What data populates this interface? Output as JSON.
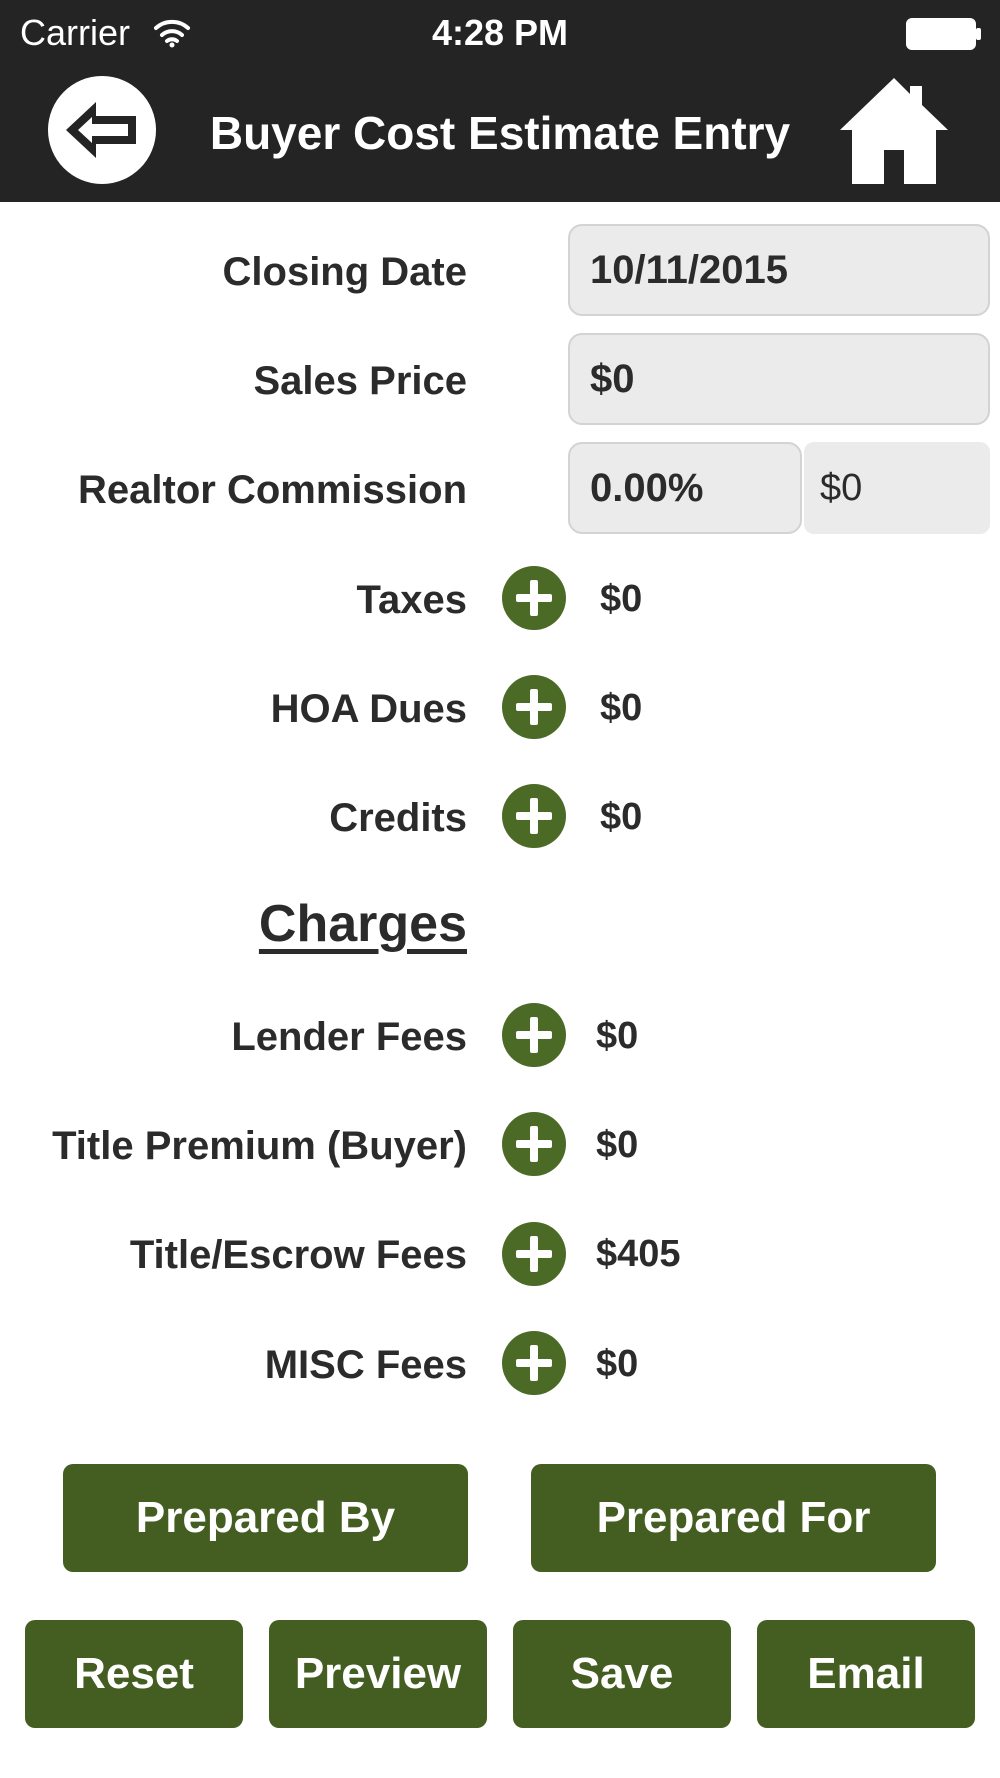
{
  "status_bar": {
    "carrier": "Carrier",
    "time": "4:28 PM"
  },
  "nav": {
    "title": "Buyer Cost Estimate Entry",
    "back_icon": "back-arrow-icon",
    "home_icon": "home-icon"
  },
  "form": {
    "closing_date": {
      "label": "Closing Date",
      "value": "10/11/2015"
    },
    "sales_price": {
      "label": "Sales Price",
      "value": "$0"
    },
    "realtor_commission": {
      "label": "Realtor Commission",
      "percent": "0.00%",
      "amount": "$0"
    },
    "taxes": {
      "label": "Taxes",
      "value": "$0"
    },
    "hoa_dues": {
      "label": "HOA Dues",
      "value": "$0"
    },
    "credits": {
      "label": "Credits",
      "value": "$0"
    }
  },
  "charges": {
    "heading": "Charges",
    "lender_fees": {
      "label": "Lender Fees",
      "value": "$0"
    },
    "title_premium": {
      "label": "Title Premium (Buyer)",
      "value": "$0"
    },
    "title_escrow_fees": {
      "label": "Title/Escrow Fees",
      "value": "$405"
    },
    "misc_fees": {
      "label": "MISC Fees",
      "value": "$0"
    }
  },
  "buttons": {
    "prepared_by": "Prepared By",
    "prepared_for": "Prepared For",
    "reset": "Reset",
    "preview": "Preview",
    "save": "Save",
    "email": "Email"
  },
  "colors": {
    "header_bg": "#242424",
    "accent_green": "#445e22",
    "field_bg": "#ebebeb"
  }
}
